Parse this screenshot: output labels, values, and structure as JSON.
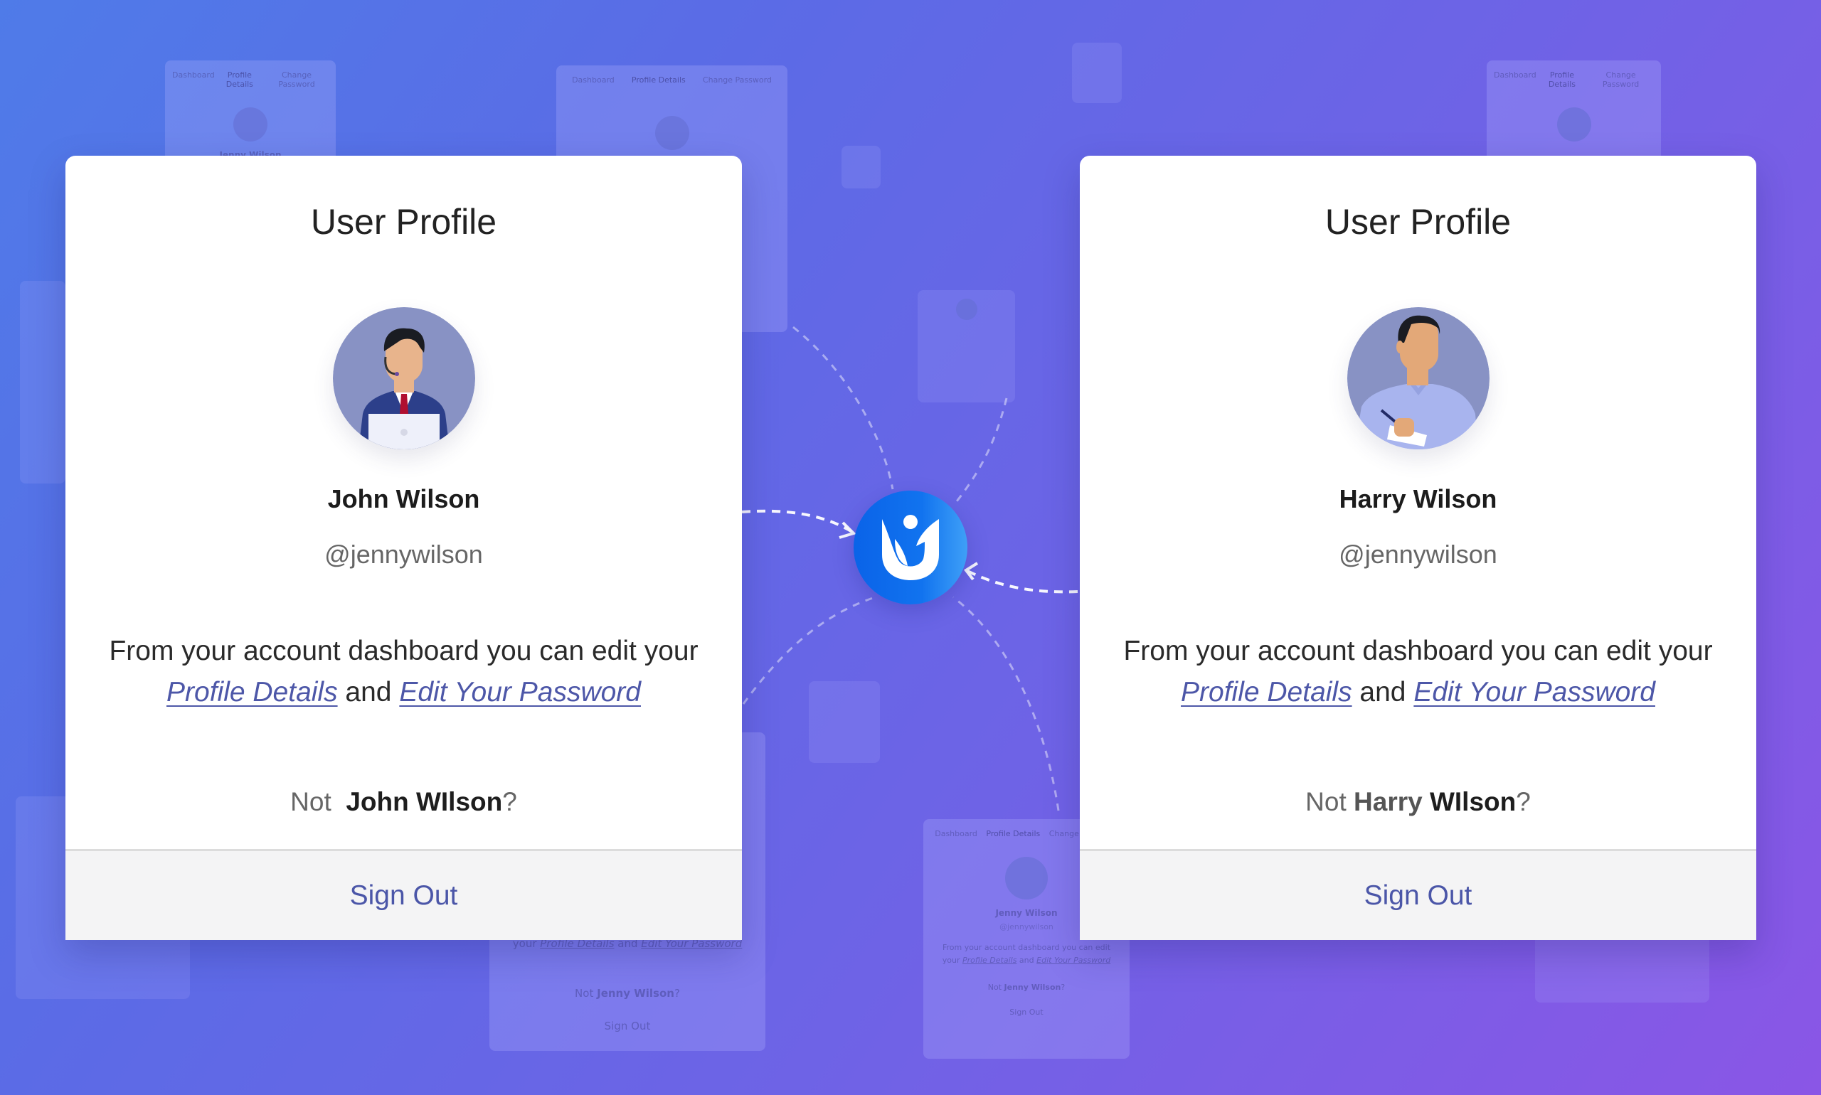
{
  "cards": [
    {
      "title": "User Profile",
      "name": "John Wilson",
      "handle": "@jennywilson",
      "description_prefix": "From your account dashboard you can edit your ",
      "link_profile": "Profile Details",
      "description_middle": " and ",
      "link_password": "Edit Your Password",
      "not_label": "Not ",
      "not_first": "John",
      "not_last": "WIlson",
      "not_suffix": "?",
      "sign_out": "Sign Out",
      "avatar": "support-agent-avatar"
    },
    {
      "title": "User Profile",
      "name": "Harry Wilson",
      "handle": "@jennywilson",
      "description_prefix": "From your account dashboard you can edit your ",
      "link_profile": "Profile Details",
      "description_middle": " and ",
      "link_password": "Edit Your Password",
      "not_label": "Not ",
      "not_first": "Harry",
      "not_last": "WIlson",
      "not_suffix": "?",
      "sign_out": "Sign Out",
      "avatar": "writing-man-avatar"
    }
  ],
  "logo": {
    "icon": "brand-logo-icon",
    "color": "#0a63e8"
  },
  "ghost_card": {
    "tabs": [
      "Dashboard",
      "Profile Details",
      "Change Password"
    ],
    "name": "Jenny Wilson",
    "handle": "@jennywilson",
    "desc_prefix": "From your account dashboard you can edit your ",
    "link_profile": "Profile Details",
    "desc_middle": " and ",
    "link_password": "Edit Your Password",
    "not_label": "Not ",
    "not_name": "Jenny Wilson",
    "not_suffix": "?",
    "sign_out": "Sign Out"
  },
  "colors": {
    "link": "#4d57a8",
    "background_start": "#4f7be8",
    "background_end": "#8a56e6"
  }
}
